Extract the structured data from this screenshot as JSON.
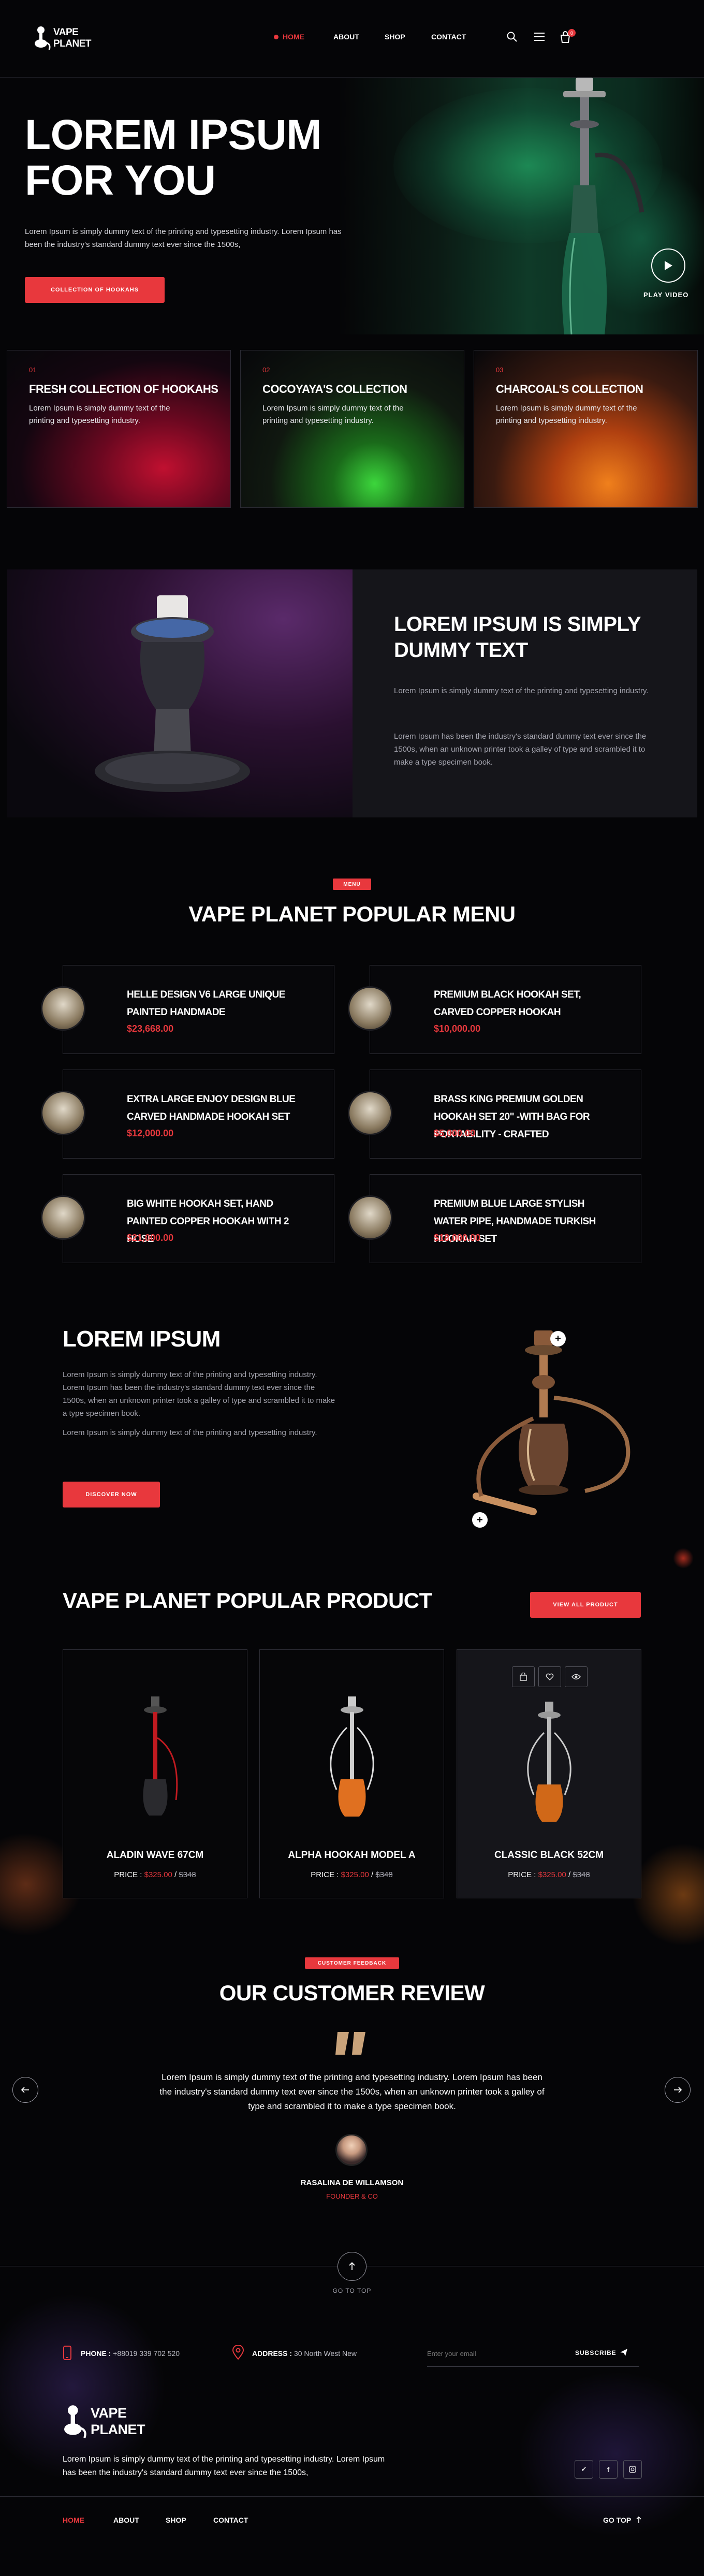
{
  "brand": {
    "logo_line1": "VAPE",
    "logo_line2": "PLANET"
  },
  "nav": {
    "home": "HOME",
    "about": "ABOUT",
    "shop": "SHOP",
    "contact": "CONTACT",
    "cart_count": "0"
  },
  "hero": {
    "title_line1": "LOREM IPSUM",
    "title_line2": "FOR YOU",
    "text": "Lorem Ipsum is simply dummy text of the printing and typesetting industry. Lorem Ipsum has been the industry's standard dummy text ever since the 1500s,",
    "button": "COLLECTION OF HOOKAHS",
    "play": "PLAY VIDEO"
  },
  "collections": [
    {
      "num": "01",
      "title": "FRESH COLLECTION OF HOOKAHS",
      "text": "Lorem Ipsum is simply dummy text of the printing and typesetting industry."
    },
    {
      "num": "02",
      "title": "COCOYAYA'S COLLECTION",
      "text": "Lorem Ipsum is simply dummy text of the printing and typesetting industry."
    },
    {
      "num": "03",
      "title": "CHARCOAL'S COLLECTION",
      "text": "Lorem Ipsum is simply dummy text of the printing and typesetting industry."
    }
  ],
  "about": {
    "title_line1": "LOREM IPSUM IS SIMPLY",
    "title_line2": "DUMMY TEXT",
    "p1": "Lorem Ipsum is simply dummy text of the printing and typesetting industry.",
    "p2": "Lorem Ipsum has been the industry's standard dummy text ever since the 1500s, when an unknown printer took a galley of type and scrambled it to make a type specimen book."
  },
  "menu": {
    "badge": "MENU",
    "title": "VAPE PLANET POPULAR MENU",
    "items": [
      {
        "name": "HELLE DESIGN V6 LARGE UNIQUE PAINTED HANDMADE",
        "price": "$23,668.00"
      },
      {
        "name": "PREMIUM BLACK HOOKAH SET, CARVED COPPER HOOKAH",
        "price": "$10,000.00"
      },
      {
        "name": "EXTRA LARGE ENJOY DESIGN BLUE CARVED HANDMADE HOOKAH SET",
        "price": "$12,000.00"
      },
      {
        "name": "BRASS KING PREMIUM GOLDEN HOOKAH SET 20\" -WITH BAG FOR PORTABILITY - CRAFTED",
        "price": "$5,000.00"
      },
      {
        "name": "BIG WHITE HOOKAH SET, HAND PAINTED COPPER HOOKAH WITH 2 HOSE",
        "price": "$21,000.00"
      },
      {
        "name": "PREMIUM BLUE LARGE STYLISH WATER PIPE, HANDMADE TURKISH HOOKAH SET",
        "price": "$18,000.00"
      }
    ]
  },
  "discover": {
    "title": "LOREM IPSUM",
    "text1": "Lorem Ipsum is simply dummy text of the printing and typesetting industry. Lorem Ipsum has been the industry's standard dummy text ever since the 1500s, when an unknown printer took a galley of type and scrambled it to make a type specimen book.",
    "text2": "Lorem Ipsum is simply dummy text of the printing and typesetting industry.",
    "button": "DISCOVER NOW"
  },
  "products": {
    "title": "VAPE PLANET POPULAR PRODUCT",
    "view_all": "VIEW ALL PRODUCT",
    "items": [
      {
        "name": "ALADIN WAVE 67CM",
        "price_label": "PRICE :",
        "price": "$325.00",
        "old_price": "$348"
      },
      {
        "name": "ALPHA HOOKAH MODEL A",
        "price_label": "PRICE :",
        "price": "$325.00",
        "old_price": "$348"
      },
      {
        "name": "CLASSIC BLACK 52CM",
        "price_label": "PRICE :",
        "price": "$325.00",
        "old_price": "$348"
      }
    ]
  },
  "review": {
    "badge": "CUSTOMER FEEDBACK",
    "title": "OUR CUSTOMER REVIEW",
    "text": "Lorem Ipsum is simply dummy text of the printing and typesetting industry. Lorem Ipsum has been the industry's standard dummy text ever since the 1500s, when an unknown printer took a galley of type and scrambled it to make a type specimen book.",
    "name": "RASALINA DE WILLAMSON",
    "role": "FOUNDER & CO"
  },
  "goto": {
    "label": "GO TO TOP"
  },
  "footer": {
    "phone_label": "PHONE :",
    "phone": "+88019 339 702 520",
    "address_label": "ADDRESS :",
    "address": "30 North West New",
    "email_placeholder": "Enter your email",
    "subscribe": "SUBSCRIBE",
    "text": "Lorem Ipsum is simply dummy text of the printing and typesetting industry. Lorem Ipsum has been the industry's standard dummy text ever since the 1500s,",
    "nav_home": "HOME",
    "nav_about": "ABOUT",
    "nav_shop": "SHOP",
    "nav_contact": "CONTACT",
    "go_top": "GO TOP"
  },
  "colors": {
    "accent": "#e8383d",
    "background": "#050507",
    "card_border": "#2d2d35"
  }
}
